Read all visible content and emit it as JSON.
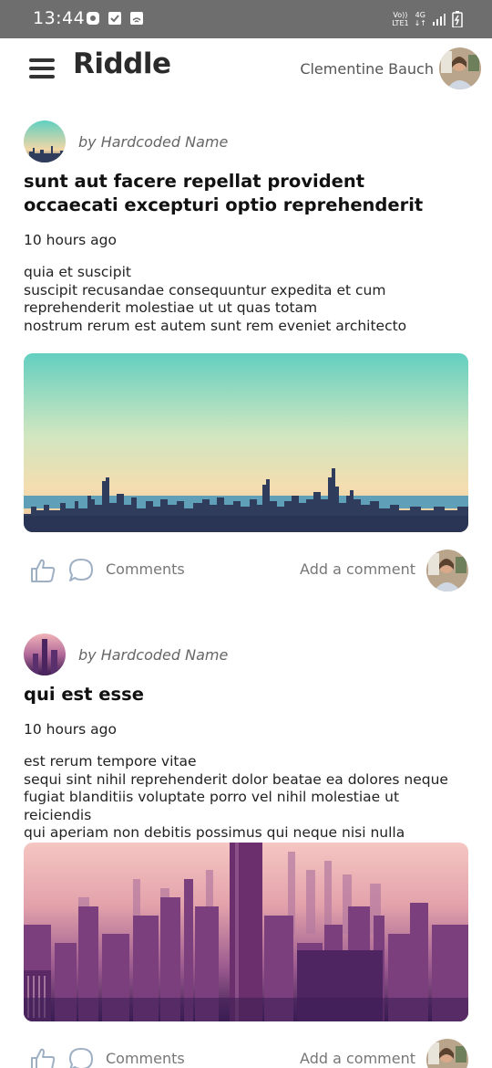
{
  "status_bar": {
    "time": "13:44",
    "network_line1": "Vo))",
    "network_line2": "LTE1",
    "network_type": "4G",
    "icons": [
      "notification-icon",
      "check-icon",
      "cast-icon",
      "signal-icon",
      "battery-icon"
    ]
  },
  "app_bar": {
    "logo": "Riddle",
    "user_name": "Clementine Bauch",
    "menu_icon": "hamburger-icon"
  },
  "posts": [
    {
      "author": "by Hardcoded Name",
      "title": "sunt aut facere repellat provident occaecati excepturi optio reprehenderit",
      "time": "10 hours ago",
      "body_lines": [
        "quia et suscipit",
        "suscipit recusandae consequuntur expedita et cum",
        "reprehenderit molestiae ut ut quas totam",
        "nostrum rerum est autem sunt rem eveniet architecto"
      ],
      "comments_label": "Comments",
      "add_comment_label": "Add a comment"
    },
    {
      "author": "by Hardcoded Name",
      "title": "qui est esse",
      "time": "10 hours ago",
      "body_lines": [
        "est rerum tempore vitae",
        "sequi sint nihil reprehenderit dolor beatae ea dolores neque",
        "fugiat blanditiis voluptate porro vel nihil molestiae ut reiciendis",
        "qui aperiam non debitis possimus qui neque nisi nulla"
      ],
      "comments_label": "Comments",
      "add_comment_label": "Add a comment"
    }
  ],
  "colors": {
    "status_bar": "#6e6e6e",
    "icon_stroke": "#9fb0c4",
    "secondary_text": "#777777"
  }
}
